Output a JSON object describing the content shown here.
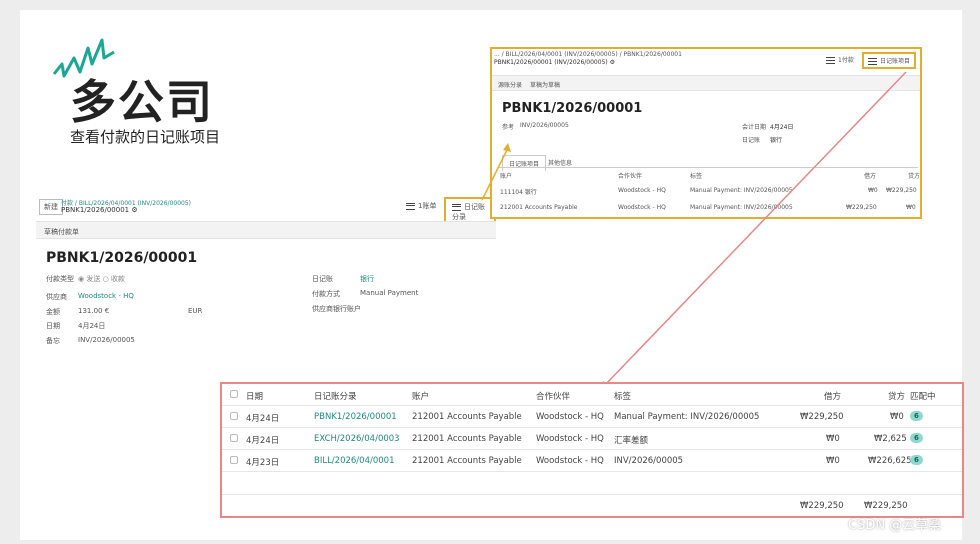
{
  "header": {
    "title": "多公司",
    "subtitle": "查看付款的日记账项目"
  },
  "left_form": {
    "new_button": "新建",
    "breadcrumb_link": "付款 / BILL/2026/04/0001 (INV/2026/00005)",
    "record_ref": "PBNK1/2026/00001",
    "one_doc_button": "1账单",
    "journal_button": "日记账分录",
    "tab_label": "草稿付款单",
    "page_title": "PBNK1/2026/00001",
    "payment_type_label": "付款类型",
    "payment_type_options": [
      "发送",
      "收款"
    ],
    "vendor_label": "供应商",
    "vendor_value": "Woodstock - HQ",
    "amount_label": "金额",
    "amount_value": "131.00 €",
    "currency_value": "EUR",
    "date_label": "日期",
    "date_value": "4月24日",
    "memo_label": "备忘",
    "memo_value": "INV/2026/00005",
    "journal_label": "日记账",
    "journal_value": "银行",
    "method_label": "付款方式",
    "method_value": "Manual Payment",
    "bank_label": "供应商银行账户"
  },
  "popup": {
    "breadcrumb_line1": "... / BILL/2026/04/0001 (INV/2026/00005) / PBNK1/2026/00001",
    "breadcrumb_line2": "PBNK1/2026/00001 (INV/2026/00005)",
    "btn1": "1付款",
    "btn2": "日记账项目",
    "tabs": [
      "源账分录",
      "草稿为草稿"
    ],
    "title": "PBNK1/2026/00001",
    "ref_label": "参考",
    "ref_value": "INV/2026/00005",
    "acc_date_label": "会计日期",
    "acc_date_value": "4月24日",
    "journal_label": "日记账",
    "journal_value": "银行",
    "subtabs": [
      "日记账项目",
      "其他信息"
    ],
    "columns": [
      "账户",
      "合作伙伴",
      "标签",
      "借方",
      "贷方"
    ],
    "rows": [
      {
        "account": "111104 银行",
        "partner": "Woodstock - HQ",
        "label": "Manual Payment: INV/2026/00005",
        "debit": "₩0",
        "credit": "₩229,250"
      },
      {
        "account": "212001 Accounts Payable",
        "partner": "Woodstock - HQ",
        "label": "Manual Payment: INV/2026/00005",
        "debit": "₩229,250",
        "credit": "₩0"
      }
    ]
  },
  "table": {
    "columns": [
      "日期",
      "日记账分录",
      "账户",
      "合作伙伴",
      "标签",
      "借方",
      "贷方",
      "匹配中"
    ],
    "rows": [
      {
        "date": "4月24日",
        "entry": "PBNK1/2026/00001",
        "account": "212001 Accounts Payable",
        "partner": "Woodstock - HQ",
        "label": "Manual Payment: INV/2026/00005",
        "debit": "₩229,250",
        "credit": "₩0",
        "match": "6"
      },
      {
        "date": "4月24日",
        "entry": "EXCH/2026/04/0003",
        "account": "212001 Accounts Payable",
        "partner": "Woodstock - HQ",
        "label": "汇率差额",
        "debit": "₩0",
        "credit": "₩2,625",
        "match": "6"
      },
      {
        "date": "4月23日",
        "entry": "BILL/2026/04/0001",
        "account": "212001 Accounts Payable",
        "partner": "Woodstock - HQ",
        "label": "INV/2026/00005",
        "debit": "₩0",
        "credit": "₩226,625",
        "match": "6"
      }
    ],
    "total_debit": "₩229,250",
    "total_credit": "₩229,250"
  },
  "watermark": "CSDN @云草桑",
  "colors": {
    "accent": "#1f8a7d",
    "highlight_yellow": "#e2ae2f",
    "highlight_red": "#e88787"
  }
}
